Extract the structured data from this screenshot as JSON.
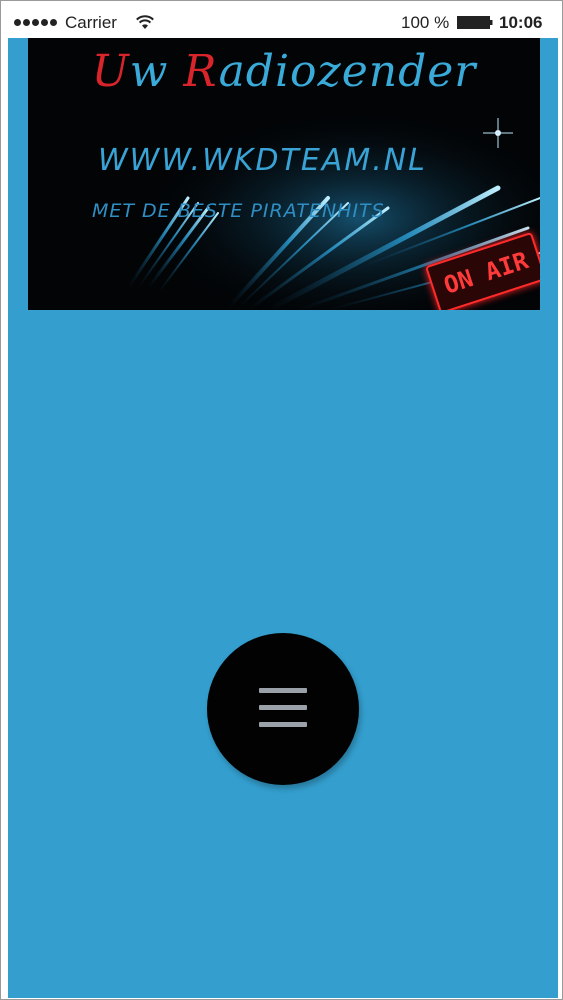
{
  "status_bar": {
    "carrier": "Carrier",
    "battery_percent": "100 %",
    "time": "10:06",
    "signal_icon": "signal-dots-icon",
    "wifi_icon": "wifi-icon",
    "battery_icon": "battery-icon"
  },
  "banner": {
    "title_first_letter_1": "U",
    "title_rest_1": "w",
    "title_first_letter_2": "R",
    "title_rest_2": "adiozender",
    "url": "WWW.WKDTEAM.NL",
    "tagline": "MET DE BESTE PIRATENHITS",
    "on_air": "ON AIR"
  },
  "menu_button": {
    "icon": "hamburger-menu-icon"
  },
  "colors": {
    "background": "#349fcf",
    "banner_bg": "#020406",
    "title_blue": "#3aaad8",
    "title_red": "#d8242b",
    "menu_button": "#020202",
    "menu_icon": "#9aa1a8"
  }
}
